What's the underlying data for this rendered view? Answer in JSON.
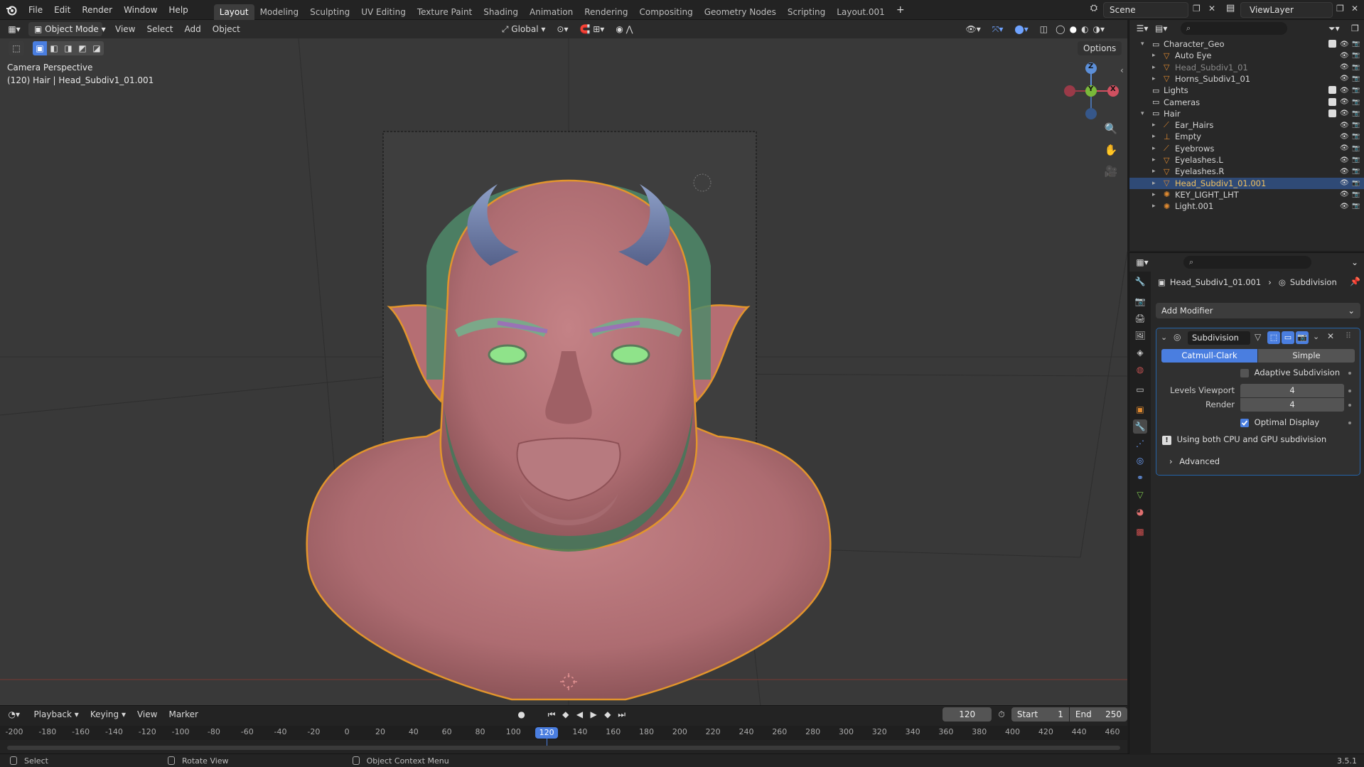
{
  "menu": [
    "File",
    "Edit",
    "Render",
    "Window",
    "Help"
  ],
  "workspaces": [
    {
      "label": "Layout",
      "active": true
    },
    {
      "label": "Modeling",
      "active": false
    },
    {
      "label": "Sculpting",
      "active": false
    },
    {
      "label": "UV Editing",
      "active": false
    },
    {
      "label": "Texture Paint",
      "active": false
    },
    {
      "label": "Shading",
      "active": false
    },
    {
      "label": "Animation",
      "active": false
    },
    {
      "label": "Rendering",
      "active": false
    },
    {
      "label": "Compositing",
      "active": false
    },
    {
      "label": "Geometry Nodes",
      "active": false
    },
    {
      "label": "Scripting",
      "active": false
    },
    {
      "label": "Layout.001",
      "active": false
    }
  ],
  "add_tab": "+",
  "scene": "Scene",
  "view_layer": "ViewLayer",
  "viewport_header": {
    "mode": "Object Mode",
    "view": "View",
    "select": "Select",
    "add": "Add",
    "object": "Object",
    "transform": "Global",
    "options": "Options"
  },
  "viewport": {
    "camera_label": "Camera Perspective",
    "object_label": "(120) Hair | Head_Subdiv1_01.001",
    "axis_x": "X",
    "axis_y": "Y",
    "axis_z": "Z"
  },
  "outliner": {
    "rows": [
      {
        "label": "Character_Geo",
        "level": 0,
        "expanded": true,
        "icon": "collection-icon",
        "dim": false,
        "selected": false
      },
      {
        "label": "Auto Eye",
        "level": 1,
        "icon": "mesh-icon",
        "dim": false,
        "selected": false
      },
      {
        "label": "Head_Subdiv1_01",
        "level": 1,
        "icon": "mesh-icon",
        "dim": true,
        "selected": false
      },
      {
        "label": "Horns_Subdiv1_01",
        "level": 1,
        "icon": "mesh-icon",
        "dim": false,
        "selected": false
      },
      {
        "label": "Lights",
        "level": 0,
        "icon": "collection-icon",
        "dim": false,
        "selected": false
      },
      {
        "label": "Cameras",
        "level": 0,
        "icon": "collection-icon",
        "dim": false,
        "selected": false
      },
      {
        "label": "Hair",
        "level": 0,
        "expanded": true,
        "icon": "collection-icon",
        "dim": false,
        "selected": false
      },
      {
        "label": "Ear_Hairs",
        "level": 1,
        "icon": "curves-icon",
        "dim": false,
        "selected": false
      },
      {
        "label": "Empty",
        "level": 1,
        "icon": "empty-icon",
        "dim": false,
        "selected": false
      },
      {
        "label": "Eyebrows",
        "level": 1,
        "icon": "curves-icon",
        "dim": false,
        "selected": false
      },
      {
        "label": "Eyelashes.L",
        "level": 1,
        "icon": "mesh-icon",
        "dim": false,
        "selected": false
      },
      {
        "label": "Eyelashes.R",
        "level": 1,
        "icon": "mesh-icon",
        "dim": false,
        "selected": false
      },
      {
        "label": "Head_Subdiv1_01.001",
        "level": 1,
        "icon": "mesh-icon",
        "dim": false,
        "selected": true
      },
      {
        "label": "KEY_LIGHT_LHT",
        "level": 1,
        "icon": "light-icon",
        "dim": false,
        "selected": false
      },
      {
        "label": "Light.001",
        "level": 1,
        "icon": "light-icon",
        "dim": false,
        "selected": false
      }
    ]
  },
  "properties": {
    "breadcrumb_object": "Head_Subdiv1_01.001",
    "breadcrumb_modifier": "Subdivision",
    "add_modifier": "Add Modifier",
    "modifier_name": "Subdivision",
    "mode_catmull": "Catmull-Clark",
    "mode_simple": "Simple",
    "adaptive": "Adaptive Subdivision",
    "levels_viewport_label": "Levels Viewport",
    "levels_viewport_value": "4",
    "render_label": "Render",
    "render_value": "4",
    "optimal_display": "Optimal Display",
    "info": "Using both CPU and GPU subdivision",
    "advanced": "Advanced"
  },
  "timeline": {
    "playback": "Playback",
    "keying": "Keying",
    "view": "View",
    "marker": "Marker",
    "current_frame": "120",
    "start_label": "Start",
    "start_value": "1",
    "end_label": "End",
    "end_value": "250",
    "ticks": [
      "-200",
      "-180",
      "-160",
      "-140",
      "-120",
      "-100",
      "-80",
      "-60",
      "-40",
      "-20",
      "0",
      "20",
      "40",
      "60",
      "80",
      "100",
      "120",
      "140",
      "160",
      "180",
      "200",
      "220",
      "240",
      "260",
      "280",
      "300",
      "320",
      "340",
      "360",
      "380",
      "400",
      "420",
      "440",
      "460"
    ]
  },
  "status": {
    "select": "Select",
    "rotate": "Rotate View",
    "context": "Object Context Menu",
    "version": "3.5.1"
  },
  "colors": {
    "accent": "#4a7ee0",
    "selected_row": "#2f4a76",
    "orange_outline": "#e2952c",
    "skin": "#b87478"
  }
}
